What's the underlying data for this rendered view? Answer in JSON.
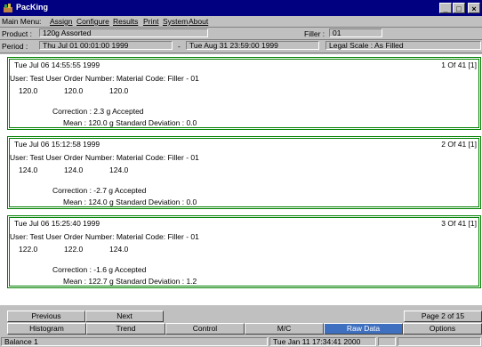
{
  "window": {
    "title": "PacKing",
    "controls": {
      "minimize": "_",
      "maximize": "□",
      "close": "×"
    }
  },
  "menu": {
    "prefix": "Main Menu:",
    "items": [
      "Assign",
      "Configure",
      "Results",
      "Print",
      "System",
      "About"
    ]
  },
  "product_row": {
    "product_label": "Product :",
    "product_value": "120g Assorted",
    "filler_label": "Filler :",
    "filler_value": "01"
  },
  "period_row": {
    "period_label": "Period :",
    "start": "Thu Jul 01 00:01:00 1999",
    "separator": "-",
    "end": "Tue Aug 31 23:59:00 1999",
    "legal_scale": "Legal Scale : As Filled"
  },
  "records": [
    {
      "timestamp": "Tue Jul 06 14:55:55 1999",
      "page": "1 Of 41 [1]",
      "header": "User: Test User  Order Number:  Material Code:  Filler - 01",
      "values": [
        "120.0",
        "120.0",
        "120.0"
      ],
      "correction": "Correction :   2.3 g  Accepted",
      "stats": "Mean :  120.0 g    Standard Deviation :   0.0"
    },
    {
      "timestamp": "Tue Jul 06 15:12:58 1999",
      "page": "2 Of 41 [1]",
      "header": "User: Test User  Order Number:  Material Code:  Filler - 01",
      "values": [
        "124.0",
        "124.0",
        "124.0"
      ],
      "correction": "Correction :  -2.7 g  Accepted",
      "stats": "Mean :  124.0 g    Standard Deviation :   0.0"
    },
    {
      "timestamp": "Tue Jul 06 15:25:40 1999",
      "page": "3 Of 41 [1]",
      "header": "User: Test User  Order Number:  Material Code:  Filler - 01",
      "values": [
        "122.0",
        "122.0",
        "124.0"
      ],
      "correction": "Correction :  -1.6 g  Accepted",
      "stats": "Mean :  122.7 g    Standard Deviation :   1.2"
    }
  ],
  "nav": {
    "previous": "Previous",
    "next": "Next",
    "page": "Page 2 of 15"
  },
  "tabs": [
    "Histogram",
    "Trend",
    "Control",
    "M/C",
    "Raw Data",
    "Options"
  ],
  "active_tab": "Raw Data",
  "status": {
    "left": "Balance 1",
    "datetime": "Tue Jan 11 17:34:41 2000"
  },
  "colors": {
    "titlebar": "#000080",
    "panel_border": "#008000",
    "active_tab": "#3f6fbf"
  }
}
